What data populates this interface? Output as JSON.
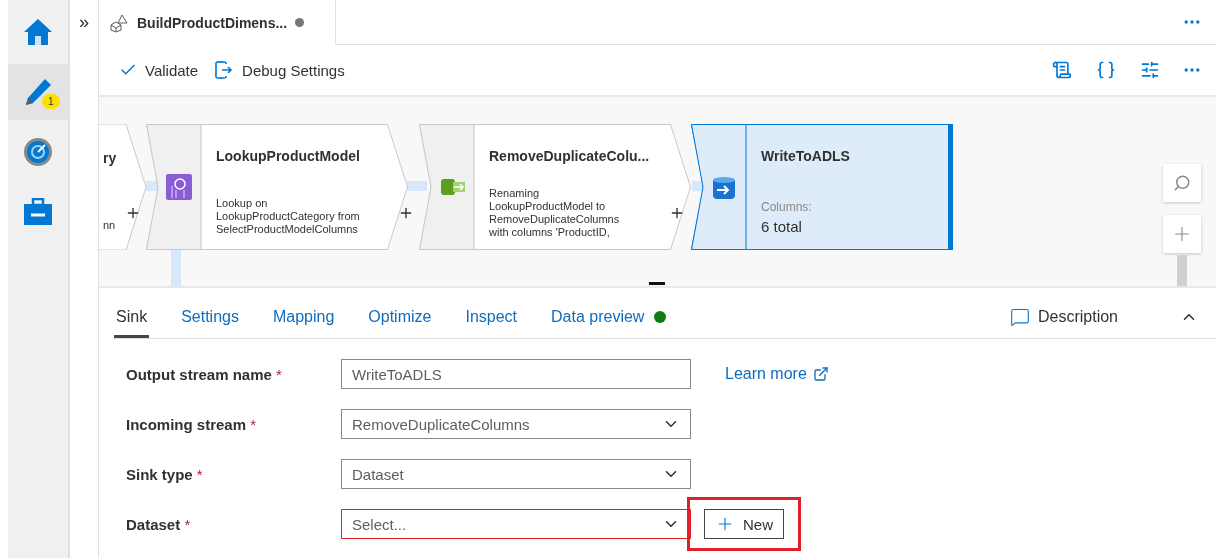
{
  "rail": {
    "items": [
      {
        "kind": "home",
        "selected": false
      },
      {
        "kind": "author",
        "selected": true,
        "badge": "1"
      },
      {
        "kind": "monitor",
        "selected": false
      },
      {
        "kind": "manage",
        "selected": false
      }
    ]
  },
  "collapse_glyph": "»",
  "tab": {
    "title": "BuildProductDimens...",
    "unsaved": true
  },
  "toolbar": {
    "buttons": [
      {
        "kind": "validate",
        "label": "Validate"
      },
      {
        "kind": "debug",
        "label": "Debug Settings"
      }
    ]
  },
  "canvas": {
    "nodes": [
      {
        "kind": "partial",
        "title": "ry",
        "description": "nn",
        "selected": false
      },
      {
        "kind": "lookup",
        "title": "LookupProductModel",
        "description": "Lookup on LookupProductCategory from SelectProductModelColumns",
        "selected": false
      },
      {
        "kind": "select",
        "title": "RemoveDuplicateColu...",
        "description": "Renaming LookupProductModel to RemoveDuplicateColumns with columns 'ProductID,",
        "selected": false
      },
      {
        "kind": "sink",
        "title": "WriteToADLS",
        "columns_label": "Columns:",
        "columns_value": "6 total",
        "selected": true
      }
    ]
  },
  "panel": {
    "tabs": [
      {
        "label": "Sink",
        "selected": true
      },
      {
        "label": "Settings",
        "selected": false
      },
      {
        "label": "Mapping",
        "selected": false
      },
      {
        "label": "Optimize",
        "selected": false
      },
      {
        "label": "Inspect",
        "selected": false
      },
      {
        "label": "Data preview",
        "selected": false,
        "ready": true
      }
    ],
    "description_button": "Description",
    "expanded": true,
    "rows": [
      {
        "kind": "text",
        "label": "Output stream name",
        "required_mark": "*",
        "value": "WriteToADLS",
        "link": "Learn more"
      },
      {
        "kind": "select",
        "label": "Incoming stream",
        "required_mark": "*",
        "value": "RemoveDuplicateColumns"
      },
      {
        "kind": "select",
        "label": "Sink type",
        "required_mark": "*",
        "value": "Dataset"
      },
      {
        "kind": "select",
        "label": "Dataset",
        "required_mark": "*",
        "placeholder": "Select...",
        "invalid": true,
        "action": {
          "label": "New",
          "highlighted": true
        }
      }
    ]
  }
}
